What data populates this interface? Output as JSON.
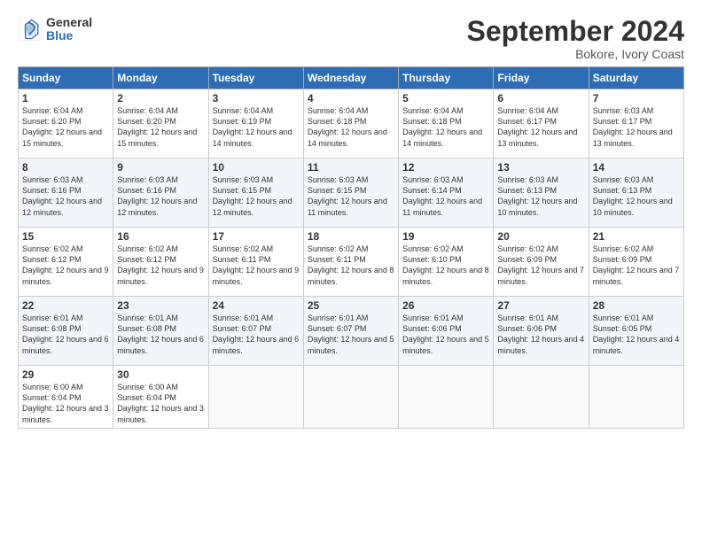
{
  "header": {
    "logo_general": "General",
    "logo_blue": "Blue",
    "month_title": "September 2024",
    "location": "Bokore, Ivory Coast"
  },
  "days_of_week": [
    "Sunday",
    "Monday",
    "Tuesday",
    "Wednesday",
    "Thursday",
    "Friday",
    "Saturday"
  ],
  "weeks": [
    [
      {
        "day": "1",
        "sunrise": "6:04 AM",
        "sunset": "6:20 PM",
        "daylight": "12 hours and 15 minutes."
      },
      {
        "day": "2",
        "sunrise": "6:04 AM",
        "sunset": "6:20 PM",
        "daylight": "12 hours and 15 minutes."
      },
      {
        "day": "3",
        "sunrise": "6:04 AM",
        "sunset": "6:19 PM",
        "daylight": "12 hours and 14 minutes."
      },
      {
        "day": "4",
        "sunrise": "6:04 AM",
        "sunset": "6:18 PM",
        "daylight": "12 hours and 14 minutes."
      },
      {
        "day": "5",
        "sunrise": "6:04 AM",
        "sunset": "6:18 PM",
        "daylight": "12 hours and 14 minutes."
      },
      {
        "day": "6",
        "sunrise": "6:04 AM",
        "sunset": "6:17 PM",
        "daylight": "12 hours and 13 minutes."
      },
      {
        "day": "7",
        "sunrise": "6:03 AM",
        "sunset": "6:17 PM",
        "daylight": "12 hours and 13 minutes."
      }
    ],
    [
      {
        "day": "8",
        "sunrise": "6:03 AM",
        "sunset": "6:16 PM",
        "daylight": "12 hours and 12 minutes."
      },
      {
        "day": "9",
        "sunrise": "6:03 AM",
        "sunset": "6:16 PM",
        "daylight": "12 hours and 12 minutes."
      },
      {
        "day": "10",
        "sunrise": "6:03 AM",
        "sunset": "6:15 PM",
        "daylight": "12 hours and 12 minutes."
      },
      {
        "day": "11",
        "sunrise": "6:03 AM",
        "sunset": "6:15 PM",
        "daylight": "12 hours and 11 minutes."
      },
      {
        "day": "12",
        "sunrise": "6:03 AM",
        "sunset": "6:14 PM",
        "daylight": "12 hours and 11 minutes."
      },
      {
        "day": "13",
        "sunrise": "6:03 AM",
        "sunset": "6:13 PM",
        "daylight": "12 hours and 10 minutes."
      },
      {
        "day": "14",
        "sunrise": "6:03 AM",
        "sunset": "6:13 PM",
        "daylight": "12 hours and 10 minutes."
      }
    ],
    [
      {
        "day": "15",
        "sunrise": "6:02 AM",
        "sunset": "6:12 PM",
        "daylight": "12 hours and 9 minutes."
      },
      {
        "day": "16",
        "sunrise": "6:02 AM",
        "sunset": "6:12 PM",
        "daylight": "12 hours and 9 minutes."
      },
      {
        "day": "17",
        "sunrise": "6:02 AM",
        "sunset": "6:11 PM",
        "daylight": "12 hours and 9 minutes."
      },
      {
        "day": "18",
        "sunrise": "6:02 AM",
        "sunset": "6:11 PM",
        "daylight": "12 hours and 8 minutes."
      },
      {
        "day": "19",
        "sunrise": "6:02 AM",
        "sunset": "6:10 PM",
        "daylight": "12 hours and 8 minutes."
      },
      {
        "day": "20",
        "sunrise": "6:02 AM",
        "sunset": "6:09 PM",
        "daylight": "12 hours and 7 minutes."
      },
      {
        "day": "21",
        "sunrise": "6:02 AM",
        "sunset": "6:09 PM",
        "daylight": "12 hours and 7 minutes."
      }
    ],
    [
      {
        "day": "22",
        "sunrise": "6:01 AM",
        "sunset": "6:08 PM",
        "daylight": "12 hours and 6 minutes."
      },
      {
        "day": "23",
        "sunrise": "6:01 AM",
        "sunset": "6:08 PM",
        "daylight": "12 hours and 6 minutes."
      },
      {
        "day": "24",
        "sunrise": "6:01 AM",
        "sunset": "6:07 PM",
        "daylight": "12 hours and 6 minutes."
      },
      {
        "day": "25",
        "sunrise": "6:01 AM",
        "sunset": "6:07 PM",
        "daylight": "12 hours and 5 minutes."
      },
      {
        "day": "26",
        "sunrise": "6:01 AM",
        "sunset": "6:06 PM",
        "daylight": "12 hours and 5 minutes."
      },
      {
        "day": "27",
        "sunrise": "6:01 AM",
        "sunset": "6:06 PM",
        "daylight": "12 hours and 4 minutes."
      },
      {
        "day": "28",
        "sunrise": "6:01 AM",
        "sunset": "6:05 PM",
        "daylight": "12 hours and 4 minutes."
      }
    ],
    [
      {
        "day": "29",
        "sunrise": "6:00 AM",
        "sunset": "6:04 PM",
        "daylight": "12 hours and 3 minutes."
      },
      {
        "day": "30",
        "sunrise": "6:00 AM",
        "sunset": "6:04 PM",
        "daylight": "12 hours and 3 minutes."
      },
      null,
      null,
      null,
      null,
      null
    ]
  ],
  "labels": {
    "sunrise": "Sunrise:",
    "sunset": "Sunset:",
    "daylight": "Daylight:"
  }
}
